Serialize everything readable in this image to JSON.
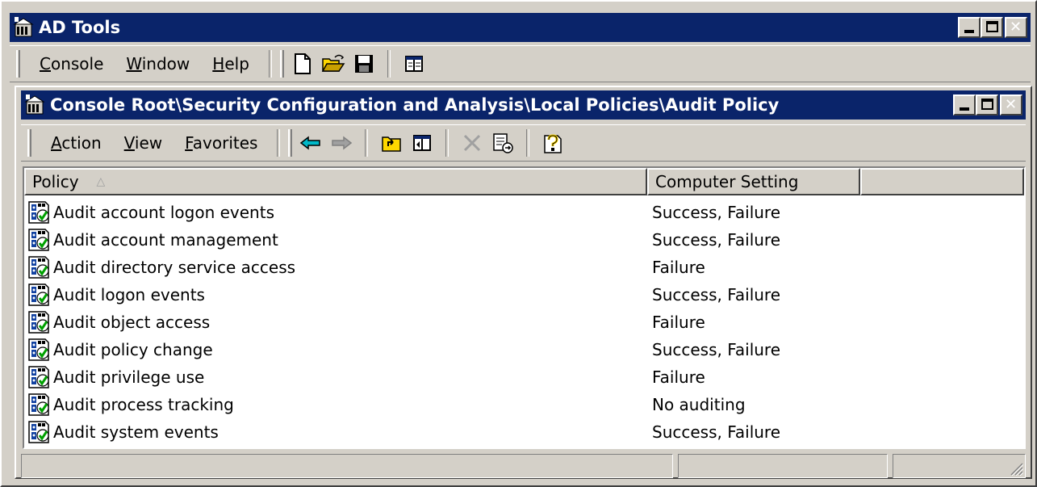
{
  "window": {
    "title": "AD Tools",
    "menu": [
      {
        "pre": "",
        "u": "C",
        "post": "onsole"
      },
      {
        "pre": "",
        "u": "W",
        "post": "indow"
      },
      {
        "pre": "",
        "u": "H",
        "post": "elp"
      }
    ]
  },
  "child": {
    "title": "Console Root\\Security Configuration and Analysis\\Local Policies\\Audit Policy",
    "menu": [
      {
        "pre": "",
        "u": "A",
        "post": "ction"
      },
      {
        "pre": "",
        "u": "V",
        "post": "iew"
      },
      {
        "pre": "",
        "u": "F",
        "post": "avorites"
      }
    ]
  },
  "list": {
    "columns": [
      "Policy",
      "Computer Setting"
    ],
    "sort_indicator": "△",
    "rows": [
      {
        "policy": "Audit account logon events",
        "setting": "Success, Failure"
      },
      {
        "policy": "Audit account management",
        "setting": "Success, Failure"
      },
      {
        "policy": "Audit directory service access",
        "setting": "Failure"
      },
      {
        "policy": "Audit logon events",
        "setting": "Success, Failure"
      },
      {
        "policy": "Audit object access",
        "setting": "Failure"
      },
      {
        "policy": "Audit policy change",
        "setting": "Success, Failure"
      },
      {
        "policy": "Audit privilege use",
        "setting": "Failure"
      },
      {
        "policy": "Audit process tracking",
        "setting": "No auditing"
      },
      {
        "policy": "Audit system events",
        "setting": "Success, Failure"
      }
    ]
  },
  "icons": [
    "mmc-app-icon",
    "new-document-icon",
    "open-folder-icon",
    "save-icon",
    "show-hide-console-tree-icon",
    "back-arrow-icon",
    "forward-arrow-icon",
    "up-one-level-icon",
    "show-hide-tree-icon",
    "delete-icon",
    "export-list-icon",
    "help-icon",
    "policy-icon"
  ],
  "colors": {
    "titlebar": "#0a246a",
    "face": "#d4d0c8"
  }
}
